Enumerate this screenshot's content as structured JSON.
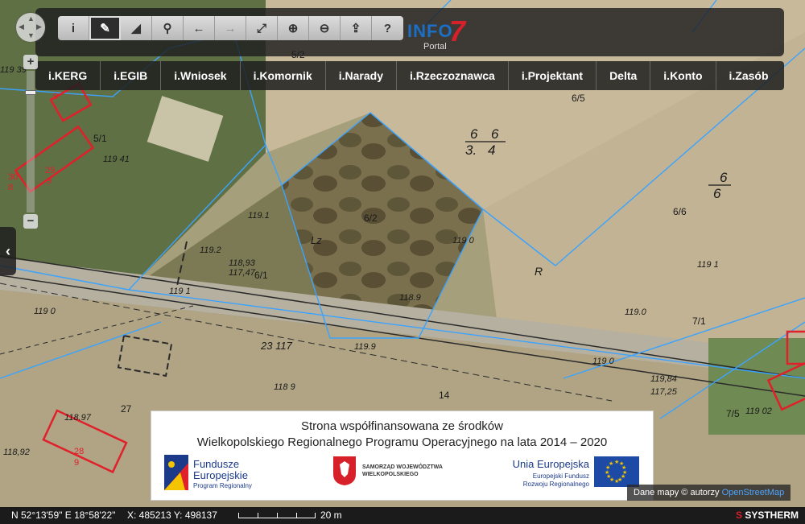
{
  "toolbar": {
    "tools": [
      {
        "name": "info-tool",
        "icon": "info-icon",
        "glyph": "i"
      },
      {
        "name": "measure-tool",
        "icon": "ruler-icon",
        "glyph": "✎"
      },
      {
        "name": "profile-tool",
        "icon": "profile-icon",
        "glyph": "◢"
      },
      {
        "name": "search-tool",
        "icon": "search-icon",
        "glyph": "⚲"
      },
      {
        "name": "back-tool",
        "icon": "arrow-left-icon",
        "glyph": "←"
      },
      {
        "name": "forward-tool",
        "icon": "arrow-right-icon",
        "glyph": "→"
      },
      {
        "name": "full-extent-tool",
        "icon": "expand-icon",
        "glyph": "⤢"
      },
      {
        "name": "zoom-in-tool",
        "icon": "zoom-in-icon",
        "glyph": "⊕"
      },
      {
        "name": "zoom-out-tool",
        "icon": "zoom-out-icon",
        "glyph": "⊖"
      },
      {
        "name": "share-tool",
        "icon": "share-icon",
        "glyph": "⇪"
      },
      {
        "name": "help-tool",
        "icon": "help-icon",
        "glyph": "?"
      }
    ]
  },
  "logo": {
    "main": "INFO",
    "seven": "7",
    "sub": "Portal"
  },
  "menu": {
    "items": [
      "i.KERG",
      "i.EGIB",
      "i.Wniosek",
      "i.Komornik",
      "i.Narady",
      "i.Rzeczoznawca",
      "i.Projektant",
      "Delta",
      "i.Konto",
      "i.Zasób"
    ]
  },
  "zoom": {
    "plus": "+",
    "minus": "−"
  },
  "side_tab": {
    "glyph": "‹"
  },
  "map_labels": {
    "parcel_52": "5/2",
    "parcel_51": "5/1",
    "parcel_65": "6/5",
    "parcel_62": "6/2",
    "parcel_66": "6/6",
    "parcel_61": "6/1",
    "parcel_71": "7/1",
    "parcel_75": "7/5",
    "parcel_14": "14",
    "parcel_27": "27",
    "bld_9": "9",
    "bld_29": "29",
    "bld_29_sub": "9",
    "bld_30": "30",
    "bld_30_sub": "8",
    "bld_28": "28",
    "bld_28_sub": "9",
    "h_11941": "119 41",
    "h_1191a": "119.1",
    "h_1192": "119.2",
    "h_1190a": "119 0",
    "h_1189a": "118.9",
    "h_11893": "118,93",
    "h_11747": "117,47",
    "h_1191b": "119 1",
    "h_1190b": "119 0",
    "h_1189b": "118 9",
    "h_1191c": "119 1",
    "h_1190c": "119.0",
    "h_1190d": "119 0",
    "h_11984": "119,84",
    "h_11725": "117,25",
    "h_11897": "118.97",
    "h_11892": "118,92",
    "h_1199": "119.9",
    "h_11939": "119 39",
    "h_11902": "119 02",
    "h_23117": "23 117",
    "lz": "Lz",
    "r": "R",
    "frac_a1": "6",
    "frac_a2": "6",
    "frac_b1": "3.",
    "frac_b2": "4",
    "frac_c1": "6",
    "frac_c2": "6"
  },
  "banner": {
    "line1": "Strona współfinansowana ze środków",
    "line2": "Wielkopolskiego Regionalnego Programu Operacyjnego na lata 2014 – 2020",
    "fe_title1": "Fundusze",
    "fe_title2": "Europejskie",
    "fe_sub": "Program Regionalny",
    "wk_line1": "SAMORZĄD WOJEWÓDZTWA",
    "wk_line2": "WIELKOPOLSKIEGO",
    "ue_title": "Unia Europejska",
    "ue_sub1": "Europejski Fundusz",
    "ue_sub2": "Rozwoju Regionalnego"
  },
  "attribution": {
    "text": "Dane mapy © autorzy ",
    "link": "OpenStreetMap"
  },
  "status": {
    "coords_geo": "N 52°13'59\" E 18°58'22\"",
    "coords_xy": "X: 485213 Y: 498137",
    "scale_label": "20 m",
    "brand_mark": "S",
    "brand_text": "SYSTHERM"
  },
  "colors": {
    "parcel_line": "#3aa3ff",
    "building": "#e0202a",
    "accent_blue": "#1b6fc4",
    "accent_red": "#d6202a"
  }
}
